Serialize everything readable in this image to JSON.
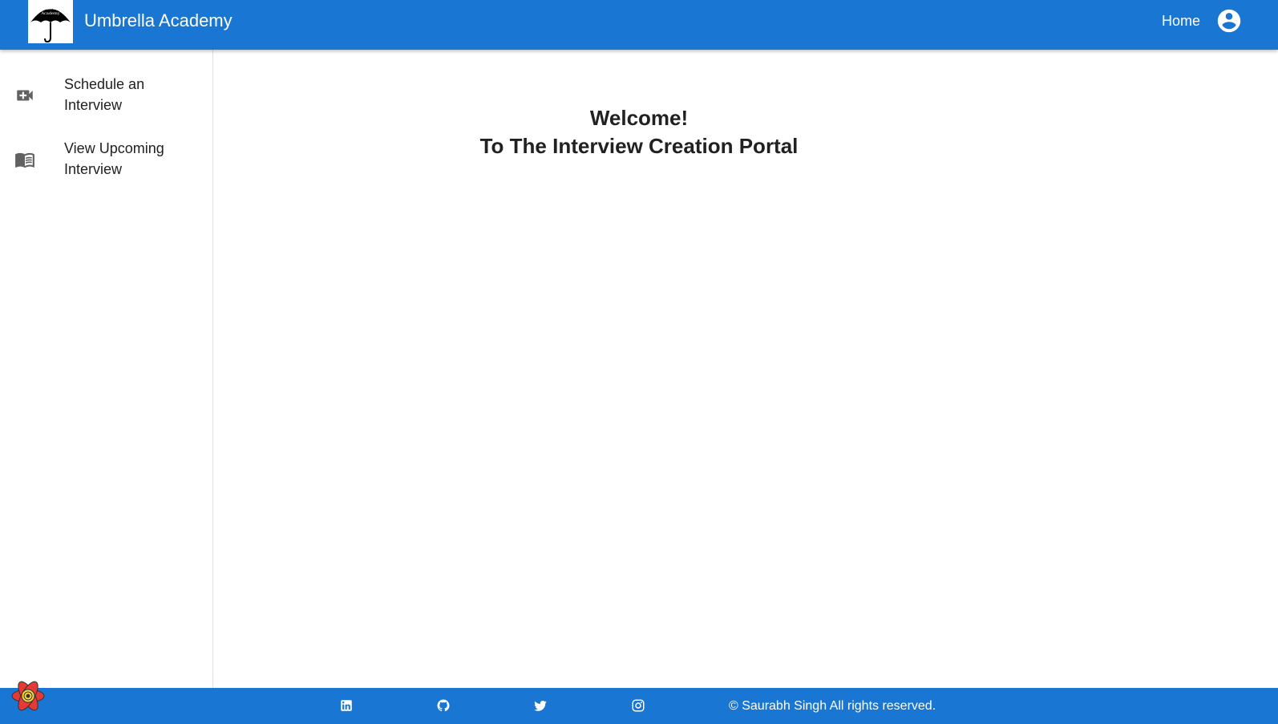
{
  "app": {
    "title": "Umbrella Academy",
    "logo_icon": "umbrella-logo-icon",
    "logo_text": "Umbrella Academy"
  },
  "header": {
    "home_label": "Home",
    "account_icon": "account-circle-icon"
  },
  "sidebar": {
    "items": [
      {
        "label": "Schedule an Interview",
        "icon": "video-call-icon"
      },
      {
        "label": "View Upcoming Interview",
        "icon": "menu-book-icon"
      }
    ]
  },
  "main": {
    "welcome_line1": "Welcome!",
    "welcome_line2": "To The Interview Creation Portal"
  },
  "footer": {
    "social_icons": [
      "linkedin-icon",
      "github-icon",
      "twitter-icon",
      "instagram-icon"
    ],
    "copyright": "© Saurabh Singh All rights reserved."
  },
  "colors": {
    "primary": "#1976d2",
    "text": "#212121",
    "icon_gray": "#616161",
    "badge_red": "#e53935",
    "badge_yellow": "#fdd835"
  }
}
